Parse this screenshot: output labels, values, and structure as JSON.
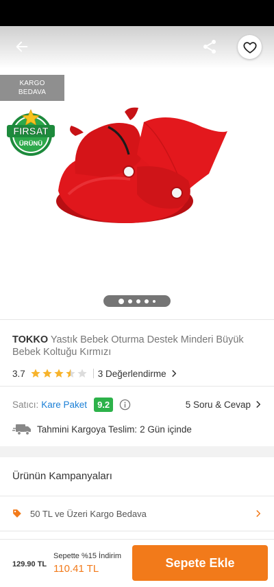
{
  "header": {
    "back_icon": "arrow-left-icon",
    "share_icon": "share-icon",
    "favorite_icon": "heart-outline-icon"
  },
  "gallery": {
    "kargo_badge_line1": "KARGO",
    "kargo_badge_line2": "BEDAVA",
    "firsat_line1": "FIRSAT",
    "firsat_line2": "ÜRÜNÜ",
    "image_count": 5,
    "active_index": 0
  },
  "product": {
    "brand": "TOKKO",
    "name": "Yastık Bebek Oturma Destek Minderi Büyük Bebek Koltuğu  Kırmızı",
    "rating": "3.7",
    "rating_value": 3.7,
    "reviews_label": "3 Değerlendirme"
  },
  "seller": {
    "label": "Satıcı:",
    "name": "Kare Paket",
    "score": "9.2",
    "qa_label": "5 Soru & Cevap"
  },
  "delivery": {
    "label": "Tahmini Kargoya Teslim:",
    "value": "2 Gün içinde"
  },
  "campaigns": {
    "title": "Ürünün Kampanyaları",
    "items": [
      {
        "label": "50 TL ve Üzeri Kargo Bedava"
      }
    ]
  },
  "bottom_bar": {
    "old_price": "129.90 TL",
    "promo_label": "Sepette %15 İndirim",
    "promo_price": "110.41 TL",
    "add_to_cart": "Sepete Ekle"
  },
  "colors": {
    "accent": "#f27a1a",
    "seller_score": "#2db24a",
    "link": "#1a7fd6",
    "star": "#f7b32b",
    "product_red": "#e0171c"
  }
}
